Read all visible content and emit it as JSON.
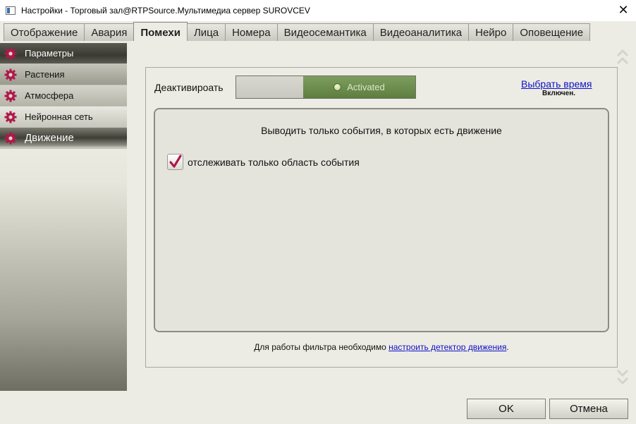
{
  "window": {
    "title": "Настройки - Торговый зал@RTPSource.Мультимедиа сервер SUROVCEV",
    "close_glyph": "✕"
  },
  "tabs": [
    {
      "label": "Отображение",
      "active": false
    },
    {
      "label": "Авария",
      "active": false
    },
    {
      "label": "Помехи",
      "active": true
    },
    {
      "label": "Лица",
      "active": false
    },
    {
      "label": "Номера",
      "active": false
    },
    {
      "label": "Видеосемантика",
      "active": false
    },
    {
      "label": "Видеоаналитика",
      "active": false
    },
    {
      "label": "Нейро",
      "active": false
    },
    {
      "label": "Оповещение",
      "active": false
    }
  ],
  "sidebar": {
    "items": [
      {
        "label": "Параметры",
        "icon": "gear-icon",
        "active": false
      },
      {
        "label": "Растения",
        "icon": "gear-icon",
        "active": false
      },
      {
        "label": "Атмосфера",
        "icon": "gear-icon",
        "active": false
      },
      {
        "label": "Нейронная сеть",
        "icon": "gear-icon",
        "active": false
      },
      {
        "label": "Движение",
        "icon": "gear-icon",
        "active": true
      }
    ]
  },
  "panel": {
    "deactivate_label": "Деактивироать",
    "toggle_state_text": "Activated",
    "schedule_link": "Выбрать время",
    "schedule_status": "Включен.",
    "inner_title": "Выводить только события, в которых есть движение",
    "checkbox_label": "отслеживать только область события",
    "checkbox_checked": true,
    "footer_text": "Для работы фильтра необходимо ",
    "footer_link": "настроить детектор движения",
    "footer_suffix": "."
  },
  "buttons": {
    "ok": "OK",
    "cancel": "Отмена"
  },
  "colors": {
    "accent_icon": "#b0184a",
    "toggle_on": "#6e8e50",
    "link": "#1010c8"
  }
}
